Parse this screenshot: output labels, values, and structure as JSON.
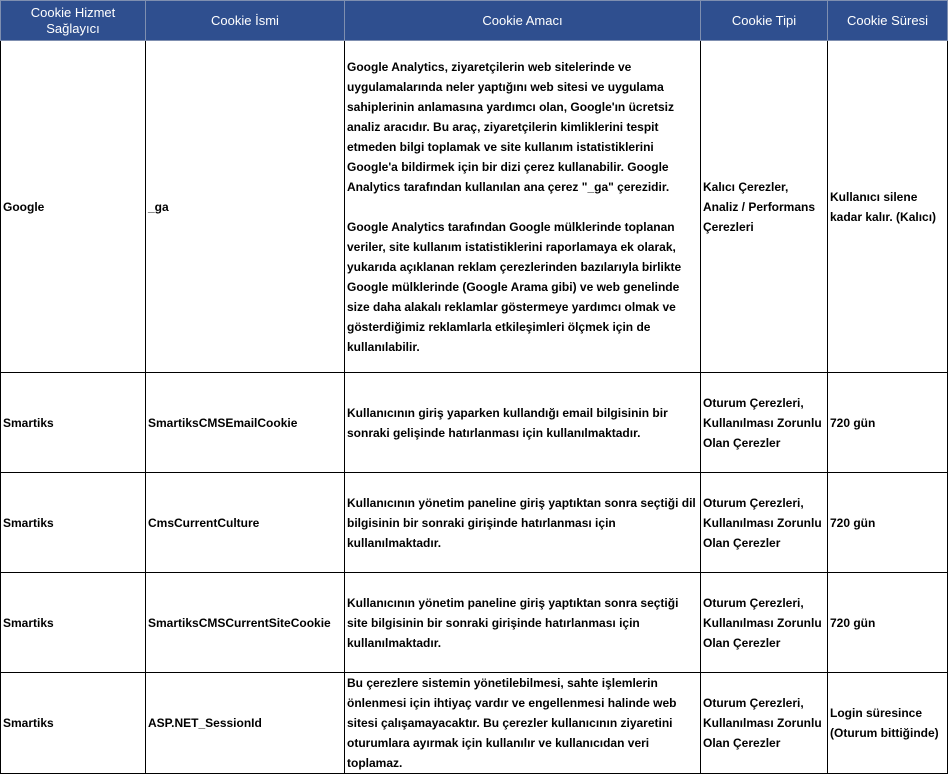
{
  "headers": [
    "Cookie Hizmet Sağlayıcı",
    "Cookie İsmi",
    "Cookie Amacı",
    "Cookie Tipi",
    "Cookie Süresi"
  ],
  "rows": [
    {
      "provider": "Google",
      "name": "_ga",
      "purpose": [
        "Google Analytics, ziyaretçilerin web sitelerinde ve uygulamalarında neler yaptığını web sitesi ve uygulama sahiplerinin anlamasına yardımcı olan, Google'ın ücretsiz analiz aracıdır. Bu araç, ziyaretçilerin kimliklerini tespit etmeden bilgi toplamak ve site kullanım istatistiklerini Google'a bildirmek için bir dizi çerez kullanabilir. Google Analytics tarafından kullanılan ana çerez \"_ga\" çerezidir.",
        "Google Analytics tarafından Google mülklerinde toplanan veriler, site kullanım istatistiklerini raporlamaya ek olarak, yukarıda açıklanan reklam çerezlerinden bazılarıyla birlikte Google mülklerinde (Google Arama gibi) ve web genelinde size daha alakalı reklamlar göstermeye yardımcı olmak ve gösterdiğimiz reklamlarla etkileşimleri ölçmek için de kullanılabilir."
      ],
      "type": "Kalıcı Çerezler, Analiz / Performans Çerezleri",
      "duration": "Kullanıcı silene kadar kalır. (Kalıcı)"
    },
    {
      "provider": "Smartiks",
      "name": "SmartiksCMSEmailCookie",
      "purpose": [
        "Kullanıcının giriş yaparken kullandığı email bilgisinin bir sonraki gelişinde hatırlanması için kullanılmaktadır."
      ],
      "type": "Oturum Çerezleri, Kullanılması Zorunlu Olan Çerezler",
      "duration": "720 gün"
    },
    {
      "provider": "Smartiks",
      "name": "CmsCurrentCulture",
      "purpose": [
        "Kullanıcının yönetim paneline giriş yaptıktan sonra seçtiği dil bilgisinin bir sonraki girişinde hatırlanması için kullanılmaktadır."
      ],
      "type": "Oturum Çerezleri, Kullanılması Zorunlu Olan Çerezler",
      "duration": "720 gün"
    },
    {
      "provider": "Smartiks",
      "name": "SmartiksCMSCurrentSiteCookie",
      "purpose": [
        "Kullanıcının yönetim paneline giriş yaptıktan sonra seçtiği site bilgisinin bir sonraki girişinde hatırlanması için kullanılmaktadır."
      ],
      "type": "Oturum Çerezleri, Kullanılması Zorunlu Olan Çerezler",
      "duration": "720 gün"
    },
    {
      "provider": "Smartiks",
      "name": "ASP.NET_SessionId",
      "purpose": [
        "Bu çerezlere sistemin yönetilebilmesi, sahte işlemlerin önlenmesi için ihtiyaç vardır ve engellenmesi halinde web sitesi çalışamayacaktır. Bu çerezler kullanıcının ziyaretini oturumlara ayırmak için kullanılır ve kullanıcıdan veri toplamaz."
      ],
      "type": "Oturum Çerezleri, Kullanılması Zorunlu Olan Çerezler",
      "duration": "Login süresince (Oturum bittiğinde)"
    }
  ]
}
